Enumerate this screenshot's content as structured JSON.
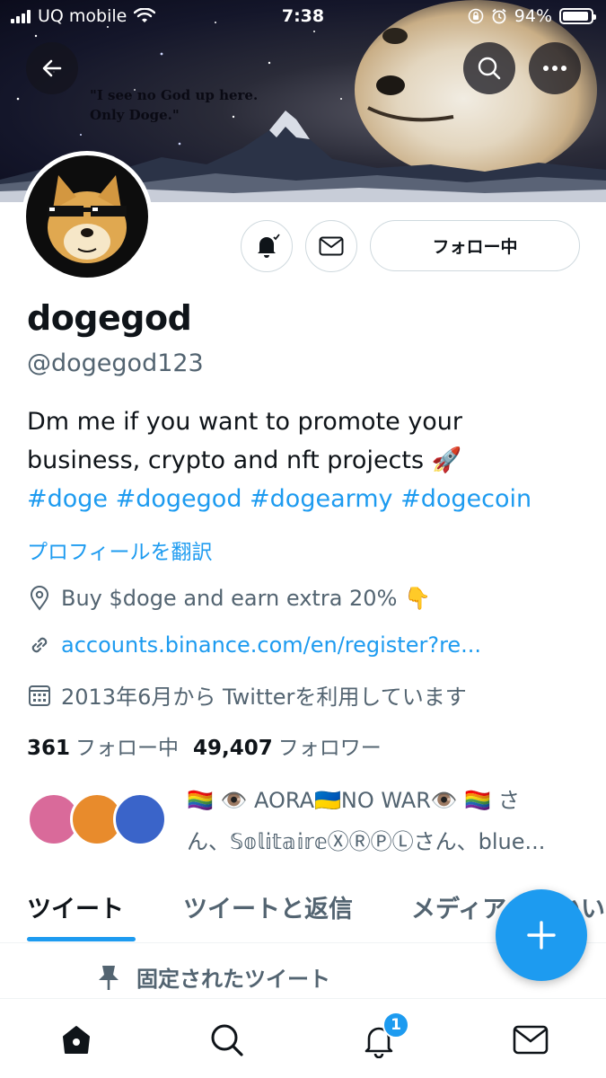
{
  "status_bar": {
    "carrier": "UQ mobile",
    "time": "7:38",
    "battery": "94%",
    "battery_level": 0.94
  },
  "banner": {
    "quote_line1": "\"I see no God up here.",
    "quote_line2": "Only Doge.\""
  },
  "profile": {
    "name": "dogegod",
    "handle": "@dogegod123",
    "follow_button": "フォロー中",
    "bio_line1": "Dm me if you want to promote your",
    "bio_line2": "business, crypto and nft projects 🚀",
    "hashtags": [
      "#doge",
      "#dogegod",
      "#dogearmy",
      "#dogecoin"
    ],
    "translate": "プロフィールを翻訳",
    "location": "Buy $doge and earn extra 20% 👇",
    "website": "accounts.binance.com/en/register?re...",
    "joined": "2013年6月から Twitterを利用しています",
    "following_count": "361",
    "following_label": "フォロー中",
    "followers_count": "49,407",
    "followers_label": "フォロワー",
    "known_followers_line1": "🏳️‍🌈 👁️ AORA🇺🇦NO WAR👁️ 🏳️‍🌈 さ",
    "known_followers_line2": "ん、𝕊𝕠𝕝𝕚𝕥𝕒𝕚𝕣𝕖ⓍⓇⓅⓁさん、blue..."
  },
  "tabs": [
    "ツイート",
    "ツイートと返信",
    "メディア",
    "いいね"
  ],
  "pinned_label": "固定されたツイート",
  "bottom_nav": {
    "notifications_badge": "1"
  },
  "colors": {
    "accent": "#1d9bf0",
    "text": "#0f1419",
    "secondary": "#536471"
  }
}
